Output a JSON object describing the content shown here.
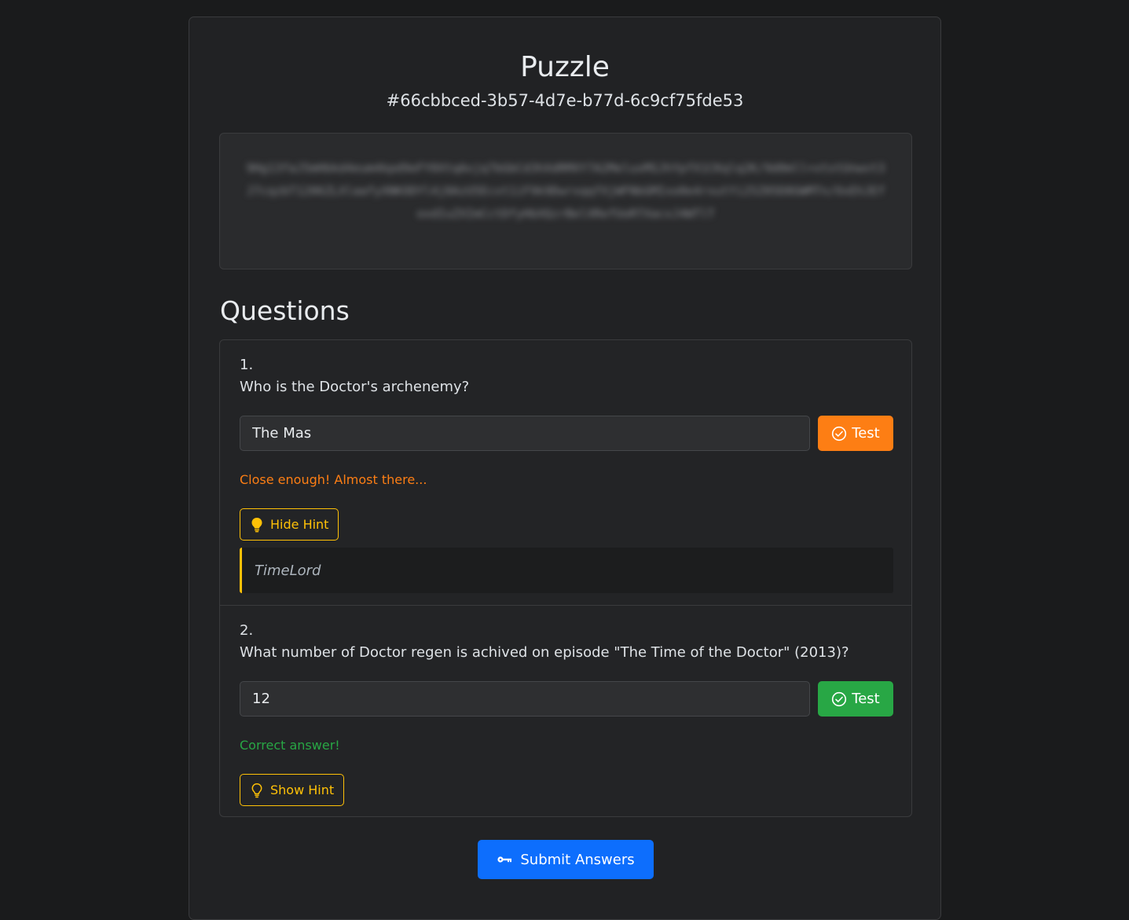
{
  "page": {
    "title": "Puzzle",
    "puzzle_id": "#66cbbced-3b57-4d7e-b77d-6c9cf75fde53"
  },
  "cipher": {
    "text": "9Hg13faJ5mHbkd4eum4kpd9eFY0XtqAxjq7bGbCd3hXdRMXY7A2MeluxMSJhYpfX1CKqlq2K/9d0mll+xtxtUnwvt3J7cqzbT1206ZLXlaafyXNKODYl4j8AzU5Ecxt1iF9k9DwrxqqfXjWFNbGMIxo0e4rxutYi25Z05D8GWMTn/OxEhJEfoxdIuZXImCctDfyHbXQzrBelXRefUoRTXacxJ4WTlT"
  },
  "questions_heading": "Questions",
  "questions": [
    {
      "number": "1.",
      "text": "Who is the Doctor's archenemy?",
      "answer_value": "The Mas",
      "test_label": "Test",
      "test_color": "#fd7e14",
      "feedback": "Close enough! Almost there...",
      "feedback_color": "#fd7e14",
      "hint_button_label": "Hide Hint",
      "hint_icon": "lightbulb-fill-icon",
      "hint_text": "TimeLord"
    },
    {
      "number": "2.",
      "text": "What number of Doctor regen is achived on episode \"The Time of the Doctor\" (2013)?",
      "answer_value": "12",
      "test_label": "Test",
      "test_color": "#28a745",
      "feedback": "Correct answer!",
      "feedback_color": "#28a745",
      "hint_button_label": "Show Hint",
      "hint_icon": "lightbulb-outline-icon"
    }
  ],
  "submit": {
    "label": "Submit Answers",
    "icon": "key-icon",
    "color": "#0d6efd"
  }
}
